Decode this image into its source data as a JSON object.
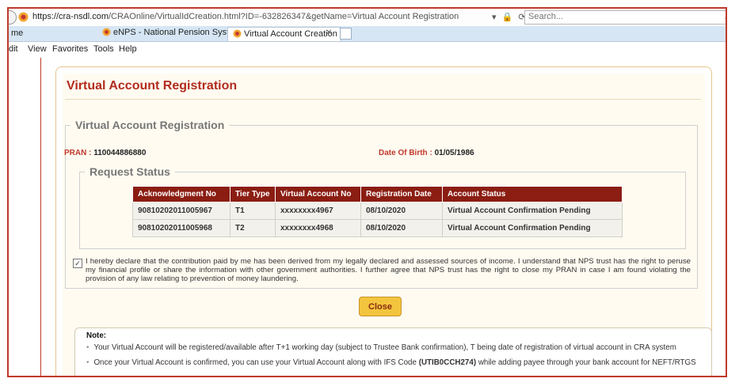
{
  "browser": {
    "url_host": "https://cra-nsdl.com",
    "url_path": "/CRAOnline/VirtualIdCreation.html?ID=-632826347&getName=Virtual Account Registration",
    "address_controls": "▾ 🔒 ⟳",
    "search_placeholder": "Search...",
    "home_tab": "me",
    "tabs": [
      {
        "label": "eNPS - National Pension System"
      },
      {
        "label": "Virtual Account Creation"
      }
    ],
    "tab_close": "✕",
    "menu": [
      "dit",
      "View",
      "Favorites",
      "Tools",
      "Help"
    ]
  },
  "page": {
    "title": "Virtual Account Registration",
    "section_legend": "Virtual Account Registration",
    "pran_label": "PRAN :",
    "pran_value": "110044886880",
    "dob_label": "Date Of Birth :",
    "dob_value": "01/05/1986",
    "request_legend": "Request Status",
    "table": {
      "headers": [
        "Acknowledgment No",
        "Tier Type",
        "Virtual Account No",
        "Registration Date",
        "Account Status"
      ],
      "rows": [
        [
          "90810202011005967",
          "T1",
          "xxxxxxxx4967",
          "08/10/2020",
          "Virtual Account Confirmation Pending"
        ],
        [
          "90810202011005968",
          "T2",
          "xxxxxxxx4968",
          "08/10/2020",
          "Virtual Account Confirmation Pending"
        ]
      ]
    },
    "declaration_checked": true,
    "declaration": "I hereby declare that the contribution paid by me has been derived from my legally declared and assessed sources of income. I understand that NPS trust has the right to peruse my financial profile or share the information with other government authorities. I further agree that NPS trust has the right to close my PRAN in case I am found violating the provision of any law relating to prevention of money laundering.",
    "close_label": "Close"
  },
  "note": {
    "title": "Note:",
    "item1": "Your Virtual Account will be registered/available after T+1 working day (subject to Trustee Bank confirmation), T being date of registration of virtual account in CRA system",
    "item2_pre": "Once your Virtual Account is confirmed, you can use your Virtual Account along with IFS Code ",
    "item2_code": "(UTIB0CCH274)",
    "item2_post": " while adding payee through your bank account for NEFT/RTGS"
  },
  "colors": {
    "title_red": "#b22c1e",
    "table_header": "#8b1d12",
    "button_yellow": "#f3c53e",
    "panel_border": "#e7c58f"
  }
}
